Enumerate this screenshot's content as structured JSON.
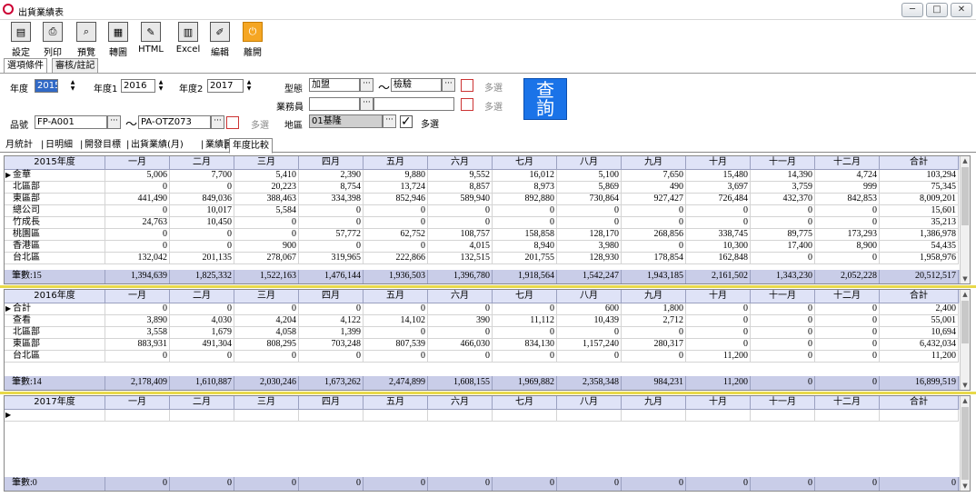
{
  "window": {
    "title": "出貨業績表",
    "controls": [
      "─",
      "□",
      "✕"
    ]
  },
  "toolbar": [
    {
      "label": "設定",
      "icon": "printer-setup-icon",
      "glyph": "▤"
    },
    {
      "label": "列印",
      "icon": "printer-icon",
      "glyph": "⎙"
    },
    {
      "label": "預覽",
      "icon": "preview-icon",
      "glyph": "⌕"
    },
    {
      "label": "轉圖",
      "icon": "chart-convert-icon",
      "glyph": "▦"
    },
    {
      "label": "HTML",
      "icon": "html-icon",
      "glyph": "✎"
    },
    {
      "label": "Excel",
      "icon": "excel-icon",
      "glyph": "▥"
    },
    {
      "label": "編輯",
      "icon": "edit-icon",
      "glyph": "✐"
    },
    {
      "label": "離開",
      "icon": "exit-icon",
      "glyph": "⏻"
    }
  ],
  "top_tabs": [
    "選項條件",
    "審核/註記"
  ],
  "options": {
    "year_label": "年度",
    "year_value": "2015",
    "year1_label": "年度1",
    "year1_value": "2016",
    "year2_label": "年度2",
    "year2_value": "2017",
    "type_label": "型態",
    "type_from": "加盟",
    "type_to": "檢驗",
    "range_sep": "～",
    "sales_label": "業務員",
    "sales_from": "",
    "sales_to": "",
    "part_label": "品號",
    "part_from": "FP-A001",
    "part_to": "PA-OTZ073",
    "region_label": "地區",
    "region_value": "01基隆",
    "multi_label": "多選",
    "query_label": "查詢"
  },
  "sub_tabs": [
    "月統計",
    "日明細",
    "開發目標",
    "出貨業績(月)",
    "業績圖",
    "年度比較"
  ],
  "columns": [
    "一月",
    "二月",
    "三月",
    "四月",
    "五月",
    "六月",
    "七月",
    "八月",
    "九月",
    "十月",
    "十一月",
    "十二月",
    "合計"
  ],
  "grids": [
    {
      "year_header": "2015年度",
      "row_labels": [
        "金華",
        "北區部",
        "東區部",
        "總公司",
        "竹成長",
        "桃園區",
        "香港區",
        "台北區"
      ],
      "rows": [
        [
          "5,006",
          "7,700",
          "5,410",
          "2,390",
          "9,880",
          "9,552",
          "16,012",
          "5,100",
          "7,650",
          "15,480",
          "14,390",
          "4,724",
          "103,294"
        ],
        [
          "0",
          "0",
          "20,223",
          "8,754",
          "13,724",
          "8,857",
          "8,973",
          "5,869",
          "490",
          "3,697",
          "3,759",
          "999",
          "75,345"
        ],
        [
          "441,490",
          "849,036",
          "388,463",
          "334,398",
          "852,946",
          "589,940",
          "892,880",
          "730,864",
          "927,427",
          "726,484",
          "432,370",
          "842,853",
          "8,009,201"
        ],
        [
          "0",
          "10,017",
          "5,584",
          "0",
          "0",
          "0",
          "0",
          "0",
          "0",
          "0",
          "0",
          "0",
          "15,601"
        ],
        [
          "24,763",
          "10,450",
          "0",
          "0",
          "0",
          "0",
          "0",
          "0",
          "0",
          "0",
          "0",
          "0",
          "35,213"
        ],
        [
          "0",
          "0",
          "0",
          "57,772",
          "62,752",
          "108,757",
          "158,858",
          "128,170",
          "268,856",
          "338,745",
          "89,775",
          "173,293",
          "1,386,978"
        ],
        [
          "0",
          "0",
          "900",
          "0",
          "0",
          "4,015",
          "8,940",
          "3,980",
          "0",
          "10,300",
          "17,400",
          "8,900",
          "54,435"
        ],
        [
          "132,042",
          "201,135",
          "278,067",
          "319,965",
          "222,866",
          "132,515",
          "201,755",
          "128,930",
          "178,854",
          "162,848",
          "0",
          "0",
          "1,958,976"
        ]
      ],
      "footer_label": "筆數:15",
      "footer": [
        "1,394,639",
        "1,825,332",
        "1,522,163",
        "1,476,144",
        "1,936,503",
        "1,396,780",
        "1,918,564",
        "1,542,247",
        "1,943,185",
        "2,161,502",
        "1,343,230",
        "2,052,228",
        "20,512,517"
      ]
    },
    {
      "year_header": "2016年度",
      "row_labels": [
        "合計",
        "查看",
        "北區部",
        "東區部",
        "台北區"
      ],
      "rows": [
        [
          "0",
          "0",
          "0",
          "0",
          "0",
          "0",
          "0",
          "600",
          "1,800",
          "0",
          "0",
          "0",
          "2,400"
        ],
        [
          "3,890",
          "4,030",
          "4,204",
          "4,122",
          "14,102",
          "390",
          "11,112",
          "10,439",
          "2,712",
          "0",
          "0",
          "0",
          "55,001"
        ],
        [
          "3,558",
          "1,679",
          "4,058",
          "1,399",
          "0",
          "0",
          "0",
          "0",
          "0",
          "0",
          "0",
          "0",
          "10,694"
        ],
        [
          "883,931",
          "491,304",
          "808,295",
          "703,248",
          "807,539",
          "466,030",
          "834,130",
          "1,157,240",
          "280,317",
          "0",
          "0",
          "0",
          "6,432,034"
        ],
        [
          "0",
          "0",
          "0",
          "0",
          "0",
          "0",
          "0",
          "0",
          "0",
          "11,200",
          "0",
          "0",
          "11,200"
        ]
      ],
      "footer_label": "筆數:14",
      "footer": [
        "2,178,409",
        "1,610,887",
        "2,030,246",
        "1,673,262",
        "2,474,899",
        "1,608,155",
        "1,969,882",
        "2,358,348",
        "984,231",
        "11,200",
        "0",
        "0",
        "16,899,519"
      ]
    },
    {
      "year_header": "2017年度",
      "row_labels": [
        ""
      ],
      "rows": [
        [
          "",
          "",
          "",
          "",
          "",
          "",
          "",
          "",
          "",
          "",
          "",
          "",
          ""
        ]
      ],
      "footer_label": "筆數:0",
      "footer": [
        "0",
        "0",
        "0",
        "0",
        "0",
        "0",
        "0",
        "0",
        "0",
        "0",
        "0",
        "0",
        "0"
      ]
    }
  ],
  "colors": {
    "header_bg": "#dfe3f7",
    "footer_bg": "#c9cde8",
    "separator": "#e8d94a",
    "query_button": "#1a73e8"
  }
}
